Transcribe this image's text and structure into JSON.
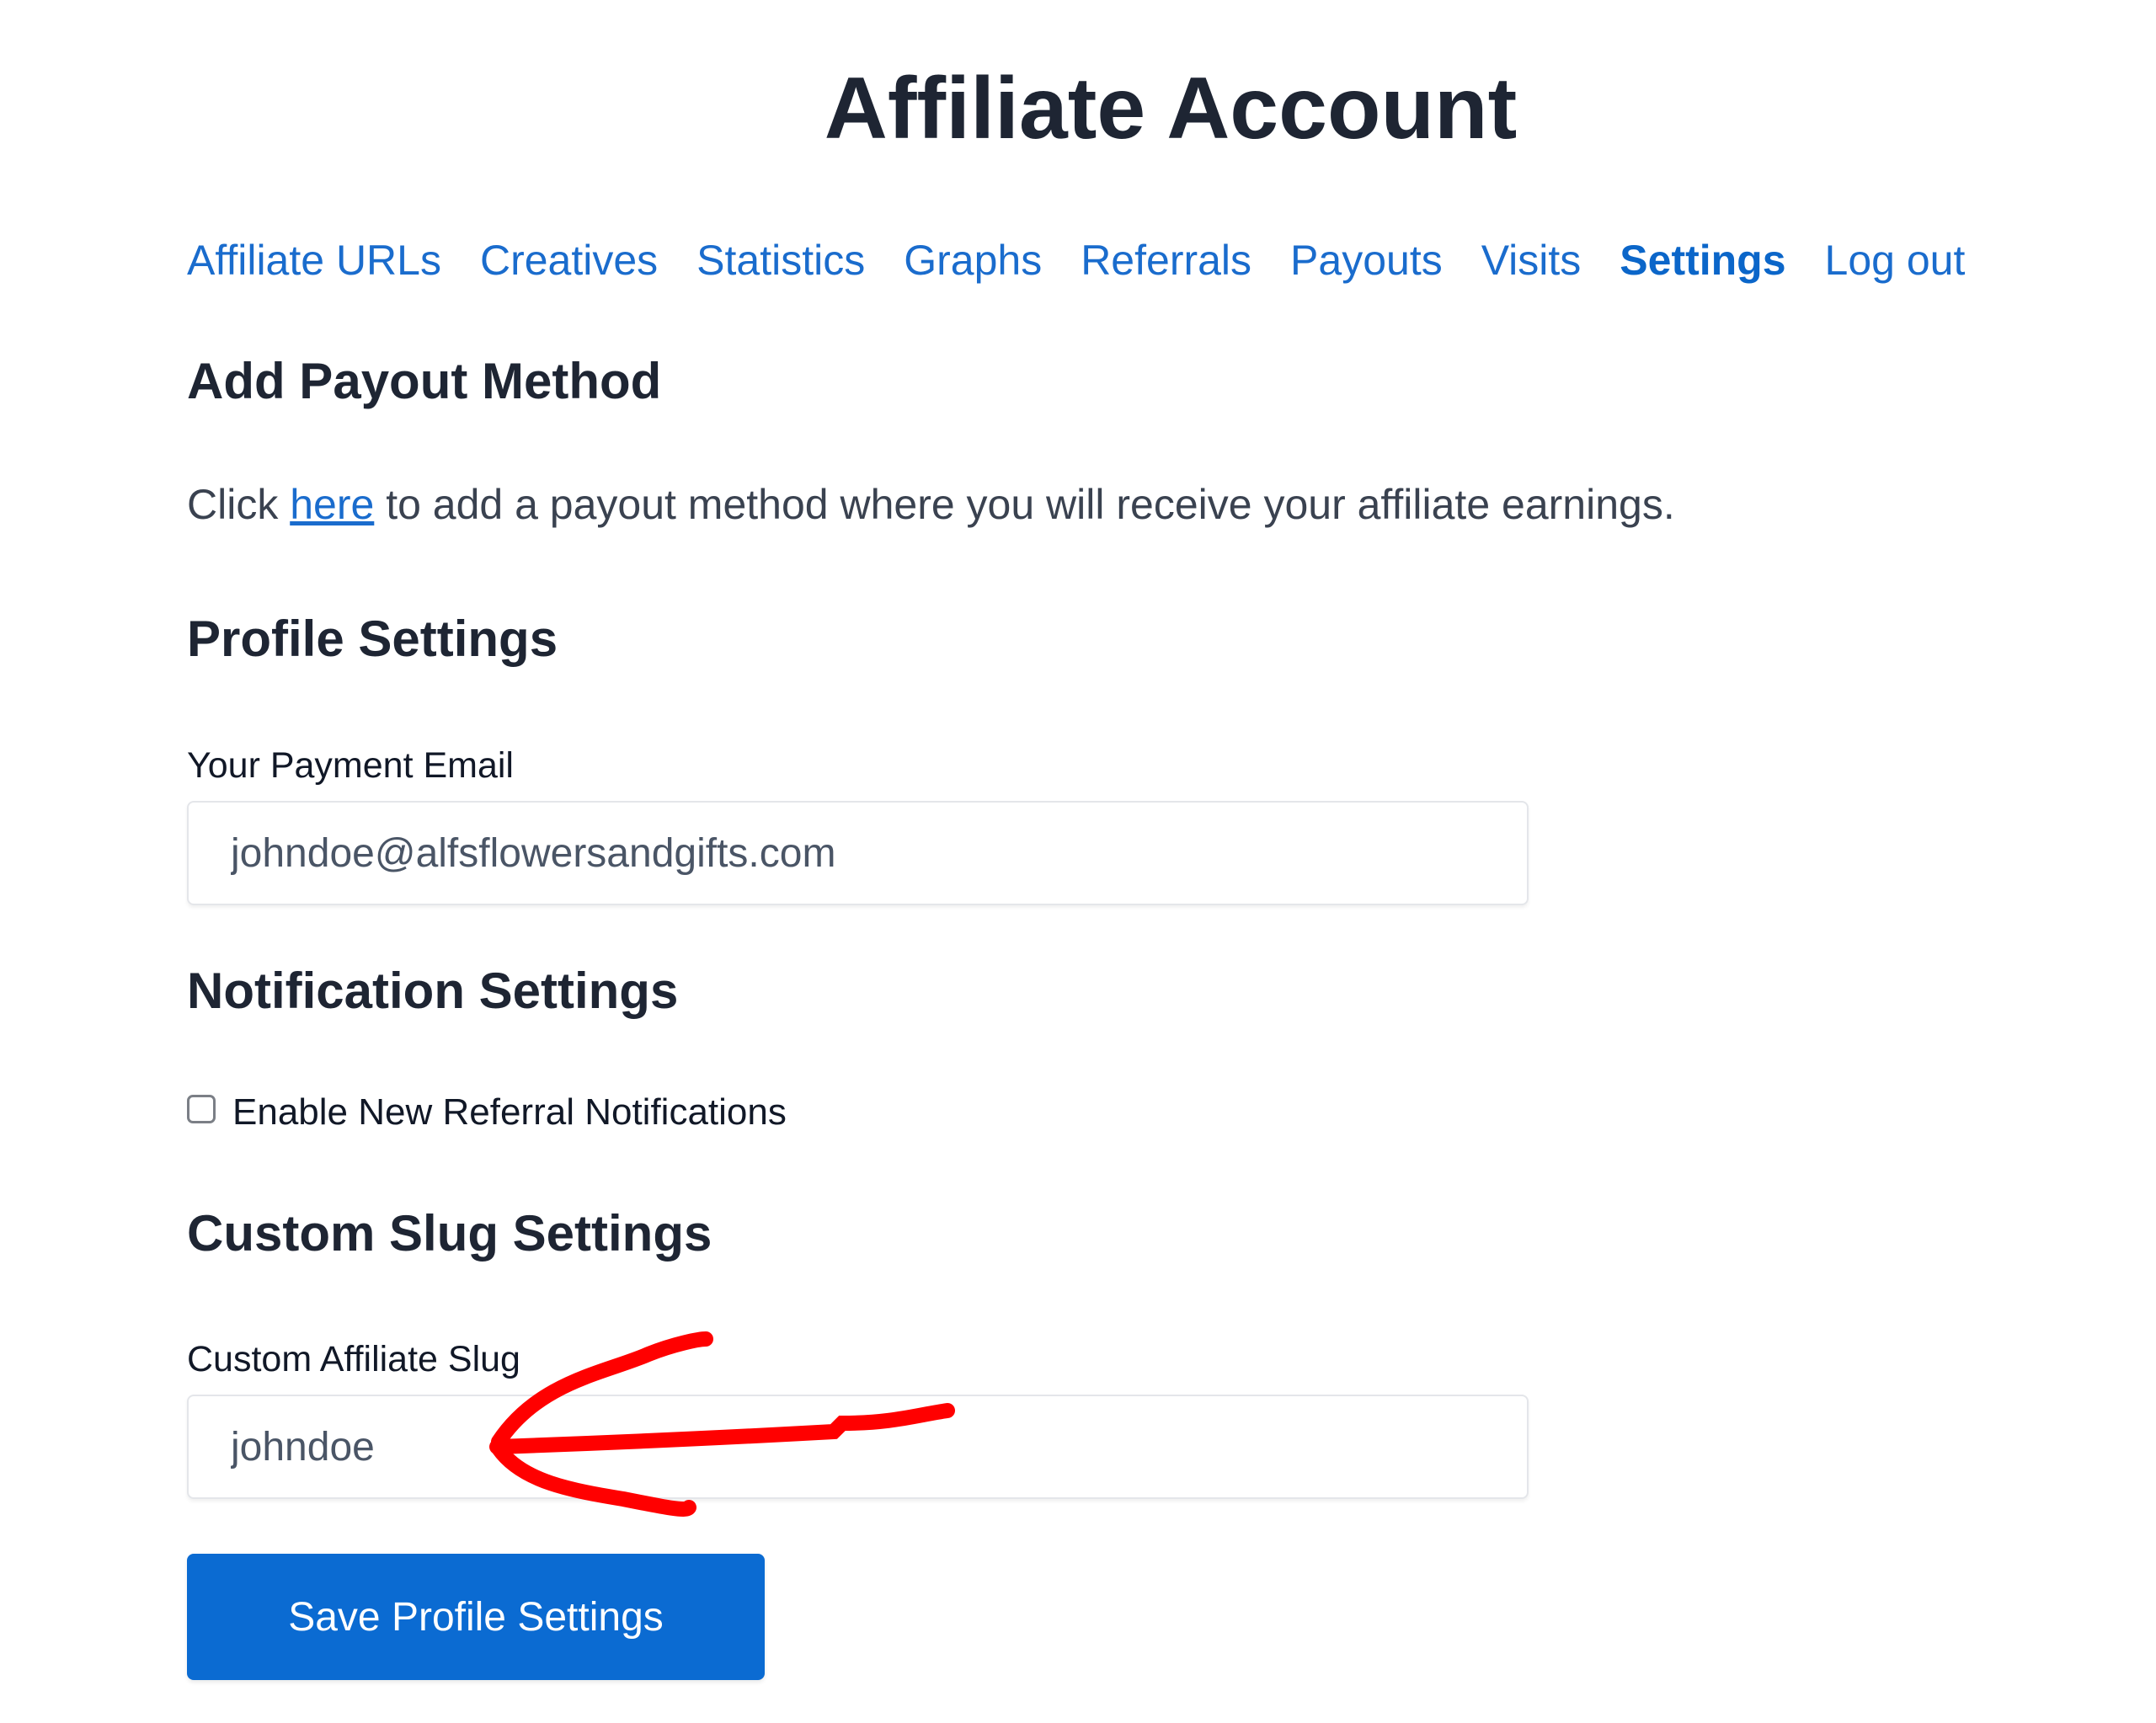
{
  "header": {
    "title": "Affiliate Account"
  },
  "nav": {
    "items": [
      {
        "label": "Affiliate URLs",
        "active": false
      },
      {
        "label": "Creatives",
        "active": false
      },
      {
        "label": "Statistics",
        "active": false
      },
      {
        "label": "Graphs",
        "active": false
      },
      {
        "label": "Referrals",
        "active": false
      },
      {
        "label": "Payouts",
        "active": false
      },
      {
        "label": "Visits",
        "active": false
      },
      {
        "label": "Settings",
        "active": true
      },
      {
        "label": "Log out",
        "active": false
      }
    ]
  },
  "payout": {
    "heading": "Add Payout Method",
    "text_before": "Click ",
    "link": "here",
    "text_after": " to add a payout method where you will receive your affiliate earnings."
  },
  "profile": {
    "heading": "Profile Settings",
    "email_label": "Your Payment Email",
    "email_value": "johndoe@alfsflowersandgifts.com"
  },
  "notifications": {
    "heading": "Notification Settings",
    "checkbox_label": "Enable New Referral Notifications",
    "checked": false
  },
  "slug": {
    "heading": "Custom Slug Settings",
    "label": "Custom Affiliate Slug",
    "value": "johndoe"
  },
  "actions": {
    "save_label": "Save Profile Settings"
  },
  "annotation": {
    "type": "arrow",
    "color": "#ff0000",
    "points_to": "custom-slug-input"
  }
}
